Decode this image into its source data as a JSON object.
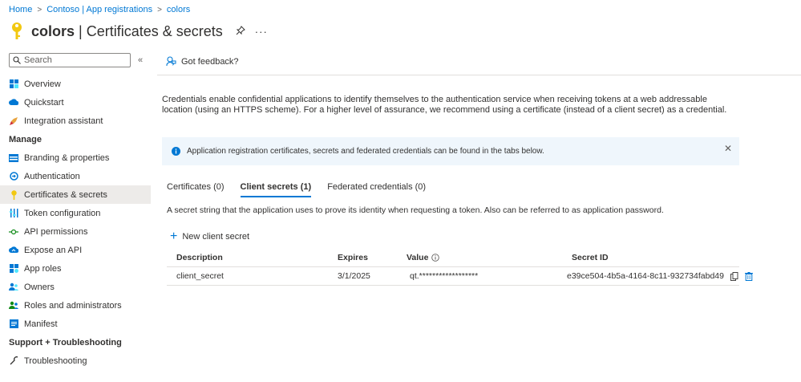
{
  "breadcrumb": [
    "Home",
    "Contoso | App registrations",
    "colors"
  ],
  "header": {
    "title_bold": "colors",
    "title_rest": "| Certificates & secrets",
    "pin_icon": "pin-icon",
    "more_label": "···"
  },
  "sidebar": {
    "search_placeholder": "Search",
    "collapse_label": "«",
    "items_top": [
      {
        "label": "Overview",
        "icon": "overview-icon"
      },
      {
        "label": "Quickstart",
        "icon": "quickstart-icon"
      },
      {
        "label": "Integration assistant",
        "icon": "rocket-icon"
      }
    ],
    "manage_heading": "Manage",
    "items_manage": [
      {
        "label": "Branding & properties",
        "icon": "branding-icon"
      },
      {
        "label": "Authentication",
        "icon": "authentication-icon"
      },
      {
        "label": "Certificates & secrets",
        "icon": "key-icon",
        "active": true
      },
      {
        "label": "Token configuration",
        "icon": "token-icon"
      },
      {
        "label": "API permissions",
        "icon": "api-permissions-icon"
      },
      {
        "label": "Expose an API",
        "icon": "cloud-icon"
      },
      {
        "label": "App roles",
        "icon": "app-roles-icon"
      },
      {
        "label": "Owners",
        "icon": "owners-icon"
      },
      {
        "label": "Roles and administrators",
        "icon": "roles-icon"
      },
      {
        "label": "Manifest",
        "icon": "manifest-icon"
      }
    ],
    "support_heading": "Support + Troubleshooting",
    "items_support": [
      {
        "label": "Troubleshooting",
        "icon": "wrench-icon"
      }
    ]
  },
  "toolbar": {
    "feedback_label": "Got feedback?"
  },
  "description": "Credentials enable confidential applications to identify themselves to the authentication service when receiving tokens at a web addressable location (using an HTTPS scheme). For a higher level of assurance, we recommend using a certificate (instead of a client secret) as a credential.",
  "info_bar": {
    "text": "Application registration certificates, secrets and federated credentials can be found in the tabs below.",
    "close_label": "✕"
  },
  "tabs": [
    {
      "label": "Certificates (0)",
      "active": false
    },
    {
      "label": "Client secrets (1)",
      "active": true
    },
    {
      "label": "Federated credentials (0)",
      "active": false
    }
  ],
  "secrets_description": "A secret string that the application uses to prove its identity when requesting a token. Also can be referred to as application password.",
  "new_secret_label": "New client secret",
  "table": {
    "headers": {
      "description": "Description",
      "expires": "Expires",
      "value": "Value",
      "secret_id": "Secret ID"
    },
    "rows": [
      {
        "description": "client_secret",
        "expires": "3/1/2025",
        "value": "qt.******************",
        "secret_id": "e39ce504-4b5a-4164-8c11-932734fabd49"
      }
    ]
  },
  "colors": {
    "accent": "#0078d4",
    "key_yellow": "#f2c811",
    "info_bg": "#eff6fc",
    "active_nav": "#edebe9"
  }
}
